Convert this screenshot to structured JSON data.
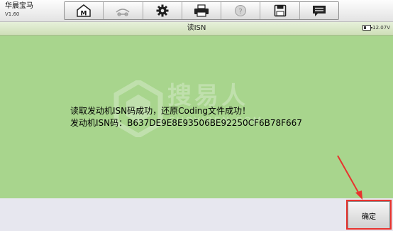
{
  "app": {
    "title": "华晨宝马",
    "version": "V1.60"
  },
  "toolbar": {
    "buttons": [
      {
        "icon": "home-icon"
      },
      {
        "icon": "car-swap-icon"
      },
      {
        "icon": "gear-icon"
      },
      {
        "icon": "printer-icon"
      },
      {
        "icon": "help-icon"
      },
      {
        "icon": "save-icon"
      },
      {
        "icon": "message-icon"
      }
    ]
  },
  "page": {
    "title": "读ISN"
  },
  "status": {
    "battery_voltage": "12.07V"
  },
  "message": {
    "line1": "读取发动机ISN码成功，还原Coding文件成功！",
    "line2": "发动机ISN码：B637DE9E8E93506BE92250CF6B78F667"
  },
  "watermark": {
    "text": "搜易人",
    "sub": "SUOYIREN.COM"
  },
  "footer": {
    "confirm_label": "确定"
  },
  "colors": {
    "content_bg": "#a8d58d",
    "highlight": "#e8332e"
  }
}
